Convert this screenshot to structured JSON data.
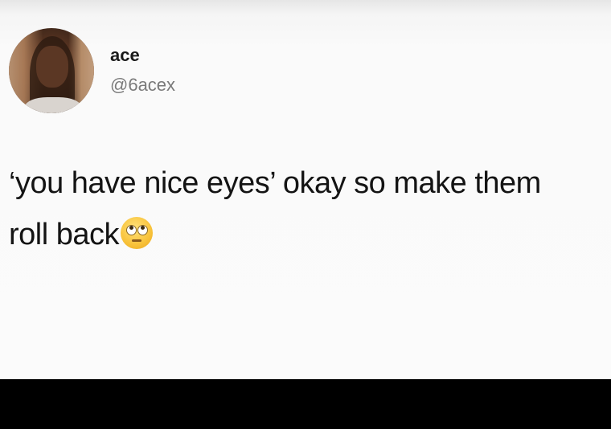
{
  "tweet": {
    "display_name": "ace",
    "handle": "@6acex",
    "text": "‘you have nice eyes’ okay so make them roll back",
    "emoji": "face-with-rolling-eyes-icon"
  },
  "colors": {
    "card_background": "#fbfbfb",
    "text": "#141414",
    "handle": "#7a7a7a",
    "bottom_bar": "#000000"
  }
}
